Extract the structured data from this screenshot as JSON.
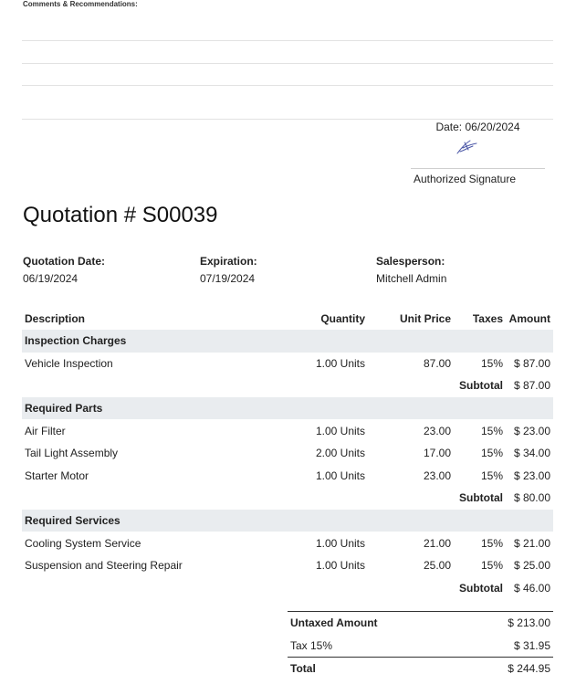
{
  "comments": {
    "title": "Comments & Recommendations:"
  },
  "signature": {
    "date": "Date: 06/20/2024",
    "label": "Authorized Signature"
  },
  "quotation": {
    "title": "Quotation # S00039",
    "quotation_date_label": "Quotation Date:",
    "quotation_date": "06/19/2024",
    "expiration_label": "Expiration:",
    "expiration": "07/19/2024",
    "salesperson_label": "Salesperson:",
    "salesperson": "Mitchell Admin"
  },
  "table": {
    "headers": [
      "Description",
      "Quantity",
      "Unit Price",
      "Taxes",
      "Amount"
    ],
    "sections": [
      {
        "name": "Inspection Charges",
        "lines": [
          {
            "description": "Vehicle Inspection",
            "quantity": "1.00 Units",
            "unit_price": "87.00",
            "taxes": "15%",
            "amount": "$ 87.00"
          }
        ],
        "subtotal_label": "Subtotal",
        "subtotal": "$ 87.00"
      },
      {
        "name": "Required Parts",
        "lines": [
          {
            "description": "Air Filter",
            "quantity": "1.00 Units",
            "unit_price": "23.00",
            "taxes": "15%",
            "amount": "$ 23.00"
          },
          {
            "description": "Tail Light Assembly",
            "quantity": "2.00 Units",
            "unit_price": "17.00",
            "taxes": "15%",
            "amount": "$ 34.00"
          },
          {
            "description": "Starter Motor",
            "quantity": "1.00 Units",
            "unit_price": "23.00",
            "taxes": "15%",
            "amount": "$ 23.00"
          }
        ],
        "subtotal_label": "Subtotal",
        "subtotal": "$ 80.00"
      },
      {
        "name": "Required Services",
        "lines": [
          {
            "description": "Cooling System Service",
            "quantity": "1.00 Units",
            "unit_price": "21.00",
            "taxes": "15%",
            "amount": "$ 21.00"
          },
          {
            "description": "Suspension and Steering Repair",
            "quantity": "1.00 Units",
            "unit_price": "25.00",
            "taxes": "15%",
            "amount": "$ 25.00"
          }
        ],
        "subtotal_label": "Subtotal",
        "subtotal": "$ 46.00"
      }
    ]
  },
  "totals": {
    "untaxed_label": "Untaxed Amount",
    "untaxed": "$ 213.00",
    "tax_label": "Tax 15%",
    "tax": "$ 31.95",
    "total_label": "Total",
    "total": "$ 244.95"
  }
}
